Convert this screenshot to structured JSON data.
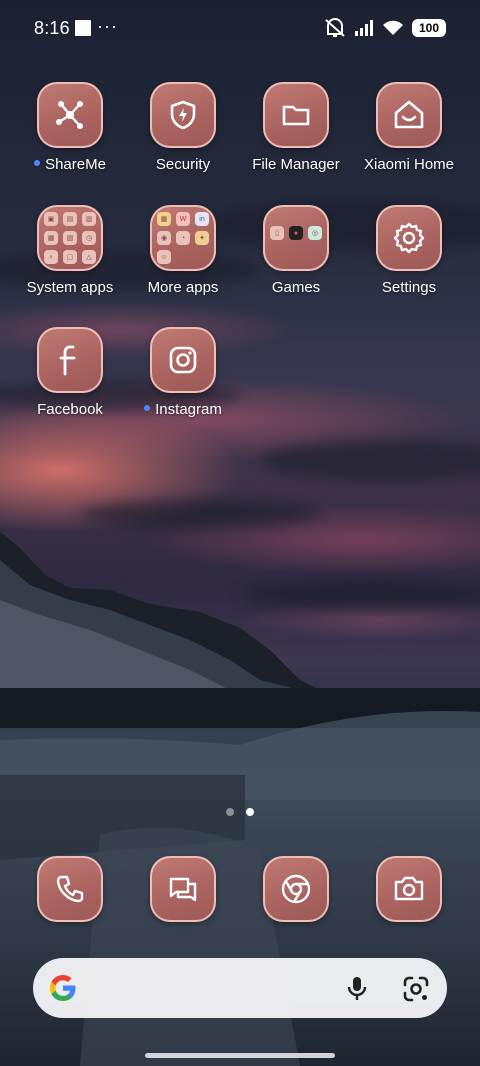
{
  "status_bar": {
    "time": "8:16",
    "overflow": "···",
    "battery": "100",
    "icons": [
      "square-notification-icon",
      "more-dots-icon",
      "muted-vibrate-icon",
      "signal-icon",
      "wifi-icon",
      "battery-icon"
    ]
  },
  "apps": [
    {
      "label": "ShareMe",
      "icon": "share-network-icon",
      "new": true
    },
    {
      "label": "Security",
      "icon": "shield-bolt-icon",
      "new": false
    },
    {
      "label": "File Manager",
      "icon": "folder-icon",
      "new": false
    },
    {
      "label": "Xiaomi Home",
      "icon": "home-smile-icon",
      "new": false
    },
    {
      "label": "System apps",
      "icon": "folder-grid-icon",
      "new": false
    },
    {
      "label": "More apps",
      "icon": "folder-grid-icon",
      "new": false
    },
    {
      "label": "Games",
      "icon": "folder-grid-icon",
      "new": false
    },
    {
      "label": "Settings",
      "icon": "gear-icon",
      "new": false
    },
    {
      "label": "Facebook",
      "icon": "facebook-icon",
      "new": false
    },
    {
      "label": "Instagram",
      "icon": "instagram-icon",
      "new": true
    }
  ],
  "page_indicator": {
    "count": 2,
    "active": 2
  },
  "dock": [
    {
      "name": "phone",
      "icon": "phone-icon"
    },
    {
      "name": "messages",
      "icon": "chat-bubbles-icon"
    },
    {
      "name": "chrome",
      "icon": "chrome-icon"
    },
    {
      "name": "camera",
      "icon": "camera-icon"
    }
  ],
  "search_bar": {
    "icons": [
      "google-g-icon",
      "microphone-icon",
      "lens-icon"
    ]
  },
  "colors": {
    "icon_fill": "#a9625f",
    "icon_border": "#f5c8c3",
    "new_dot": "#4a8cff",
    "search_bg": "#f2f2f6"
  }
}
